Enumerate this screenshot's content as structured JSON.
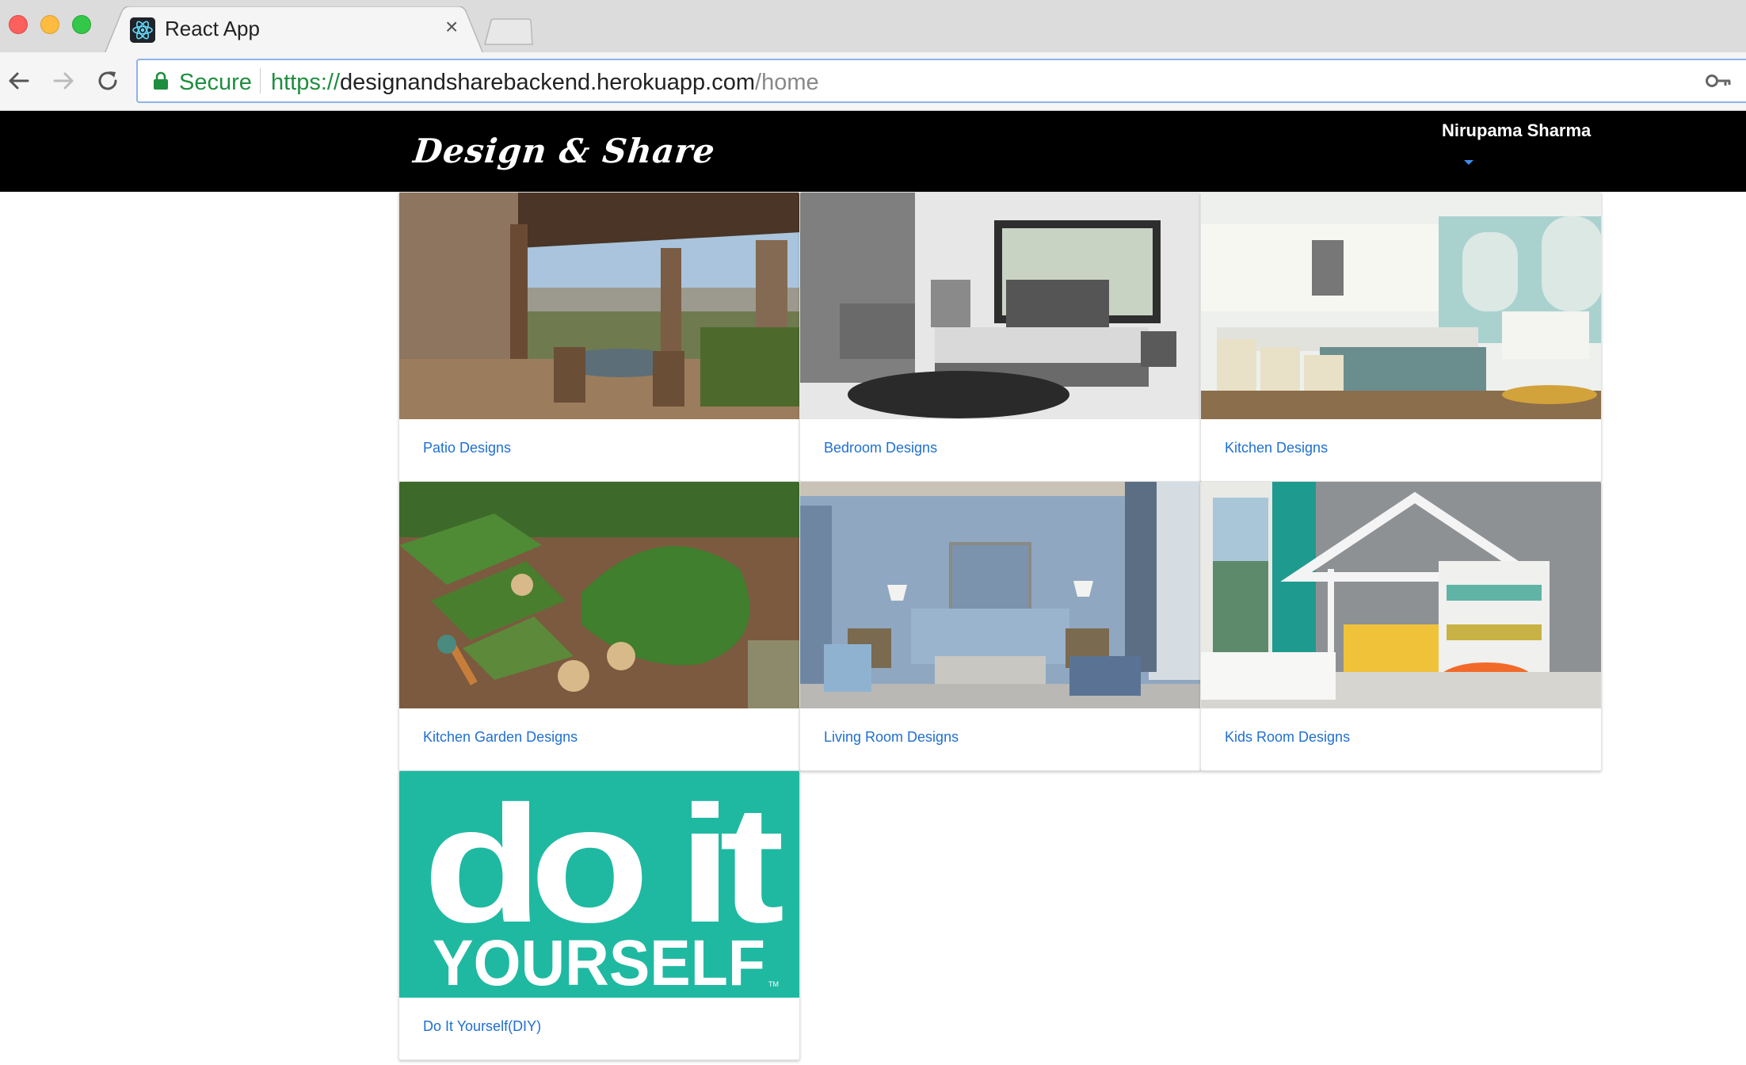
{
  "browser": {
    "tab_title": "React App",
    "tab_close": "×",
    "secure_label": "Secure",
    "url_scheme": "https://",
    "url_host": "designandsharebackend.herokuapp.com",
    "url_path": "/home",
    "icons": [
      "back-icon",
      "forward-icon",
      "reload-icon",
      "lock-icon",
      "key-icon",
      "react-logo-icon",
      "close-icon"
    ]
  },
  "navbar": {
    "logo_text": "Design & Share",
    "user_name": "Nirupama Sharma",
    "colors": {
      "background": "#000000",
      "caret": "#3b8ef0"
    }
  },
  "cards": [
    {
      "label": "Patio Designs"
    },
    {
      "label": "Bedroom Designs"
    },
    {
      "label": "Kitchen Designs"
    },
    {
      "label": "Kitchen Garden Designs"
    },
    {
      "label": "Living Room Designs"
    },
    {
      "label": "Kids Room Designs"
    },
    {
      "label": "Do It Yourself(DIY)",
      "image_text": {
        "line1": "do it",
        "line2": "YOURSELF",
        "mark": "TM"
      }
    }
  ],
  "colors": {
    "link": "#1f6fd0",
    "secure_green": "#1e8e3e",
    "diy_teal": "#1fb9a2"
  }
}
